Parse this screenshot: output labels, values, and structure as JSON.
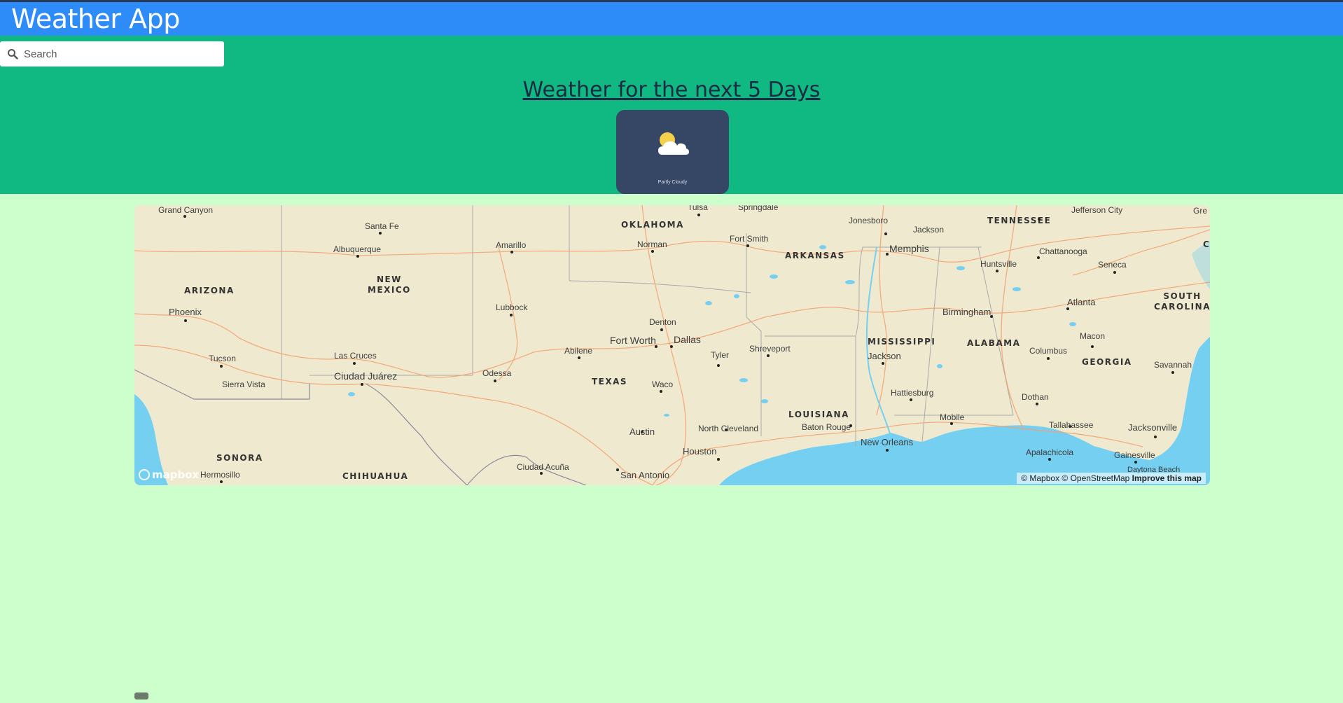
{
  "app": {
    "title": "Weather App"
  },
  "search": {
    "placeholder": "Search",
    "icon": "search-icon"
  },
  "forecast": {
    "title": "Weather for the next 5 Days",
    "days": [
      {
        "condition": "Partly Cloudy",
        "icon": "partly-cloudy-icon"
      }
    ]
  },
  "map": {
    "states": {
      "arizona": "ARIZONA",
      "new_mexico_1": "NEW",
      "new_mexico_2": "MEXICO",
      "oklahoma": "OKLAHOMA",
      "arkansas": "ARKANSAS",
      "tennessee": "TENNESSEE",
      "south_carolina_1": "SOUTH",
      "south_carolina_2": "CAROLINA",
      "texas": "TEXAS",
      "mississippi": "MISSISSIPPI",
      "alabama": "ALABAMA",
      "georgia": "GEORGIA",
      "louisiana": "LOUISIANA",
      "sonora": "SONORA",
      "chihuahua": "CHIHUAHUA"
    },
    "cities": {
      "grand_canyon": "Grand Canyon",
      "santa_fe": "Santa Fe",
      "albuquerque": "Albuquerque",
      "amarillo": "Amarillo",
      "tulsa": "Tulsa",
      "springdale": "Springdale",
      "norman": "Norman",
      "fort_smith": "Fort Smith",
      "jonesboro": "Jonesboro",
      "jackson_tn": "Jackson",
      "memphis": "Memphis",
      "jefferson_city": "Jefferson City",
      "chattanooga": "Chattanooga",
      "huntsville": "Huntsville",
      "seneca": "Seneca",
      "phoenix": "Phoenix",
      "lubbock": "Lubbock",
      "denton": "Denton",
      "birmingham": "Birmingham",
      "atlanta": "Atlanta",
      "tucson": "Tucson",
      "las_cruces": "Las Cruces",
      "abilene": "Abilene",
      "fort_worth": "Fort Worth",
      "dallas": "Dallas",
      "tyler": "Tyler",
      "shreveport": "Shreveport",
      "jackson_ms": "Jackson",
      "columbus": "Columbus",
      "macon": "Macon",
      "savannah": "Savannah",
      "sierra_vista": "Sierra Vista",
      "ciudad_juarez": "Ciudad Juárez",
      "odessa": "Odessa",
      "waco": "Waco",
      "hattiesburg": "Hattiesburg",
      "dothan": "Dothan",
      "austin": "Austin",
      "north_cleveland": "North Cleveland",
      "baton_rouge": "Baton Rouge",
      "mobile": "Mobile",
      "tallahassee": "Tallahassee",
      "jacksonville": "Jacksonville",
      "new_orleans": "New Orleans",
      "houston": "Houston",
      "apalachicola": "Apalachicola",
      "gainesville": "Gainesville",
      "hermosillo": "Hermosillo",
      "ciudad_acuna": "Ciudad Acuña",
      "san_antonio": "San Antonio",
      "daytona_beach": "Daytona Beach",
      "gre": "Gre",
      "ca": "CA"
    },
    "logo": "mapbox",
    "attribution": {
      "text": "© Mapbox © OpenStreetMap",
      "improve": "Improve this map"
    },
    "colors": {
      "land": "#efeacf",
      "water": "#75cff0",
      "roads": "#f4a071"
    }
  },
  "colors": {
    "topbar": "#2e8cf8",
    "hero": "#10b981",
    "page": "#ccffcc",
    "card": "#364766"
  }
}
